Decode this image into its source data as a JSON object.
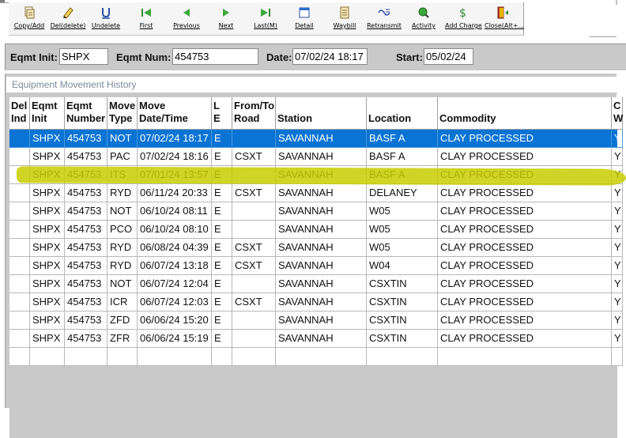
{
  "toolbar": {
    "buttons": [
      {
        "label": "Copy/Add",
        "icon": "copy-add-icon"
      },
      {
        "label": "Del(delete)",
        "icon": "delete-icon"
      },
      {
        "label": "Undelete",
        "icon": "undelete-icon"
      },
      {
        "label": "First",
        "icon": "first-icon"
      },
      {
        "label": "Previous",
        "icon": "previous-icon"
      },
      {
        "label": "Next",
        "icon": "next-icon"
      },
      {
        "label": "Last(M)",
        "icon": "last-icon"
      },
      {
        "label": "Detail",
        "icon": "detail-icon"
      },
      {
        "label": "Waybill",
        "icon": "waybill-icon"
      },
      {
        "label": "Retransmit",
        "icon": "retransmit-icon"
      },
      {
        "label": "Activity",
        "icon": "activity-icon"
      },
      {
        "label": "Add Charge",
        "icon": "dollar-icon"
      },
      {
        "label": "Close(Alt+...",
        "icon": "close-door-icon"
      }
    ]
  },
  "filter": {
    "eqmt_init_label": "Eqmt Init:",
    "eqmt_init_value": "SHPX",
    "eqmt_num_label": "Eqmt Num:",
    "eqmt_num_value": "454753",
    "date_label": "Date:",
    "date_value": "07/02/24 18:17",
    "start_label": "Start:",
    "start_value": "05/02/24"
  },
  "history": {
    "title": "Equipment Movement History",
    "columns": [
      {
        "line1": "Del",
        "line2": "Ind"
      },
      {
        "line1": "Eqmt",
        "line2": "Init"
      },
      {
        "line1": "Eqmt",
        "line2": "Number"
      },
      {
        "line1": "Move",
        "line2": "Type"
      },
      {
        "line1": "Move",
        "line2": "Date/Time"
      },
      {
        "line1": "L",
        "line2": "E"
      },
      {
        "line1": "From/To",
        "line2": "Road"
      },
      {
        "line1": "",
        "line2": "Station"
      },
      {
        "line1": "",
        "line2": "Location"
      },
      {
        "line1": "",
        "line2": "Commodity"
      },
      {
        "line1": "C",
        "line2": "W"
      }
    ],
    "rows": [
      {
        "del": "",
        "init": "SHPX",
        "number": "454753",
        "type": "NOT",
        "datetime": "07/02/24 18:17",
        "le": "E",
        "road": "",
        "station": "SAVANNAH",
        "location": "BASF A",
        "commodity": "CLAY PROCESSED",
        "extra": "Y"
      },
      {
        "del": "",
        "init": "SHPX",
        "number": "454753",
        "type": "PAC",
        "datetime": "07/02/24 18:16",
        "le": "E",
        "road": "CSXT",
        "station": "SAVANNAH",
        "location": "BASF A",
        "commodity": "CLAY PROCESSED",
        "extra": "Y"
      },
      {
        "del": "",
        "init": "SHPX",
        "number": "454753",
        "type": "ITS",
        "datetime": "07/01/24 13:57",
        "le": "E",
        "road": "",
        "station": "SAVANNAH",
        "location": "BASF A",
        "commodity": "CLAY PROCESSED",
        "extra": "Y"
      },
      {
        "del": "",
        "init": "SHPX",
        "number": "454753",
        "type": "RYD",
        "datetime": "06/11/24 20:33",
        "le": "E",
        "road": "CSXT",
        "station": "SAVANNAH",
        "location": "DELANEY",
        "commodity": "CLAY PROCESSED",
        "extra": "Y"
      },
      {
        "del": "",
        "init": "SHPX",
        "number": "454753",
        "type": "NOT",
        "datetime": "06/10/24 08:11",
        "le": "E",
        "road": "",
        "station": "SAVANNAH",
        "location": "W05",
        "commodity": "CLAY PROCESSED",
        "extra": "Y"
      },
      {
        "del": "",
        "init": "SHPX",
        "number": "454753",
        "type": "PCO",
        "datetime": "06/10/24 08:10",
        "le": "E",
        "road": "",
        "station": "SAVANNAH",
        "location": "W05",
        "commodity": "CLAY PROCESSED",
        "extra": "Y"
      },
      {
        "del": "",
        "init": "SHPX",
        "number": "454753",
        "type": "RYD",
        "datetime": "06/08/24 04:39",
        "le": "E",
        "road": "CSXT",
        "station": "SAVANNAH",
        "location": "W05",
        "commodity": "CLAY PROCESSED",
        "extra": "Y"
      },
      {
        "del": "",
        "init": "SHPX",
        "number": "454753",
        "type": "RYD",
        "datetime": "06/07/24 13:18",
        "le": "E",
        "road": "CSXT",
        "station": "SAVANNAH",
        "location": "W04",
        "commodity": "CLAY PROCESSED",
        "extra": "Y"
      },
      {
        "del": "",
        "init": "SHPX",
        "number": "454753",
        "type": "NOT",
        "datetime": "06/07/24 12:04",
        "le": "E",
        "road": "",
        "station": "SAVANNAH",
        "location": "CSXTIN",
        "commodity": "CLAY PROCESSED",
        "extra": "Y"
      },
      {
        "del": "",
        "init": "SHPX",
        "number": "454753",
        "type": "ICR",
        "datetime": "06/07/24 12:03",
        "le": "E",
        "road": "CSXT",
        "station": "SAVANNAH",
        "location": "CSXTIN",
        "commodity": "CLAY PROCESSED",
        "extra": "Y"
      },
      {
        "del": "",
        "init": "SHPX",
        "number": "454753",
        "type": "ZFD",
        "datetime": "06/06/24 15:20",
        "le": "E",
        "road": "",
        "station": "SAVANNAH",
        "location": "CSXTIN",
        "commodity": "CLAY PROCESSED",
        "extra": "Y"
      },
      {
        "del": "",
        "init": "SHPX",
        "number": "454753",
        "type": "ZFR",
        "datetime": "06/06/24 15:19",
        "le": "E",
        "road": "",
        "station": "SAVANNAH",
        "location": "CSXTIN",
        "commodity": "CLAY PROCESSED",
        "extra": "Y"
      },
      {
        "del": "",
        "init": "",
        "number": "",
        "type": "",
        "datetime": "",
        "le": "",
        "road": "",
        "station": "",
        "location": "",
        "commodity": "",
        "extra": ""
      }
    ],
    "selected_row": 0,
    "highlighted_row": 2
  },
  "colors": {
    "selection": "#0a74d4",
    "highlighter": "#c8cd00",
    "panel_bg": "#c9c9c9"
  }
}
